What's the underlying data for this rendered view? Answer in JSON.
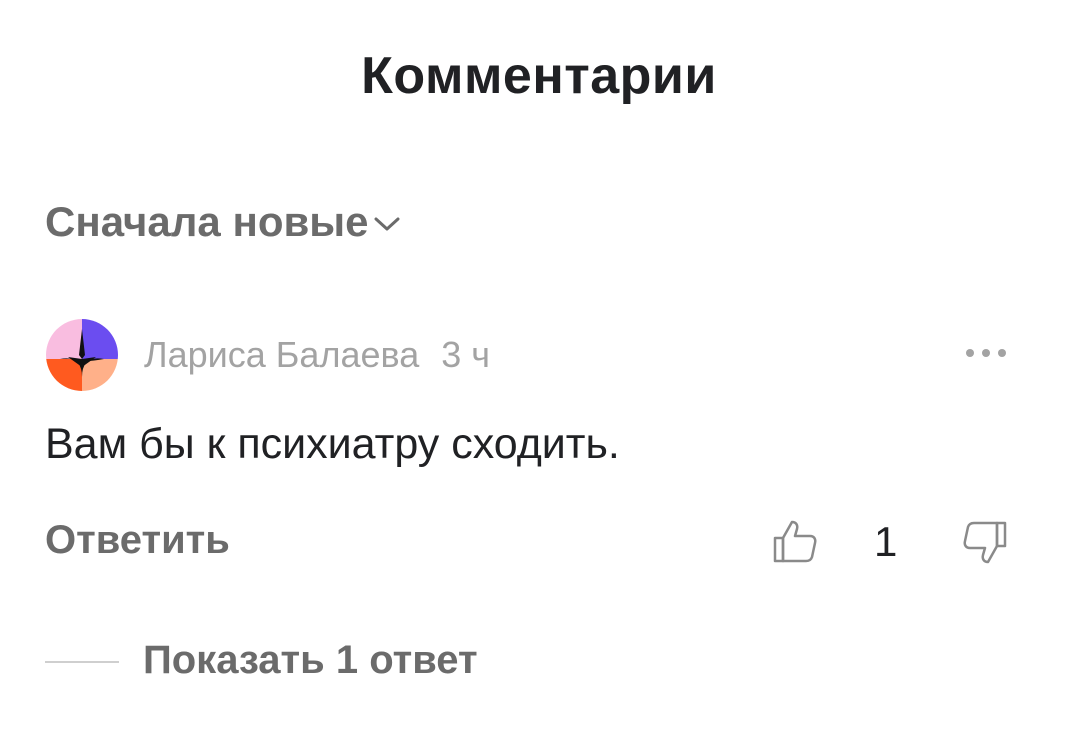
{
  "header": {
    "title": "Комментарии"
  },
  "sort": {
    "label": "Сначала новые",
    "chevron_icon": "chevron-down-icon"
  },
  "comment": {
    "author": "Лариса Балаева",
    "time": "3 ч",
    "text": "Вам бы к психиатру сходить.",
    "reply_label": "Ответить",
    "likes": "1",
    "more_icon": "more-dots-icon",
    "like_icon": "thumbs-up-icon",
    "dislike_icon": "thumbs-down-icon",
    "avatar_colors": [
      "#f9bde0",
      "#6b4df0",
      "#ff5a1f",
      "#ffb089"
    ]
  },
  "replies": {
    "show_label": "Показать 1 ответ"
  },
  "colors": {
    "text_primary": "#202124",
    "text_secondary": "#6b6b6b",
    "text_muted": "#a3a3a3"
  }
}
